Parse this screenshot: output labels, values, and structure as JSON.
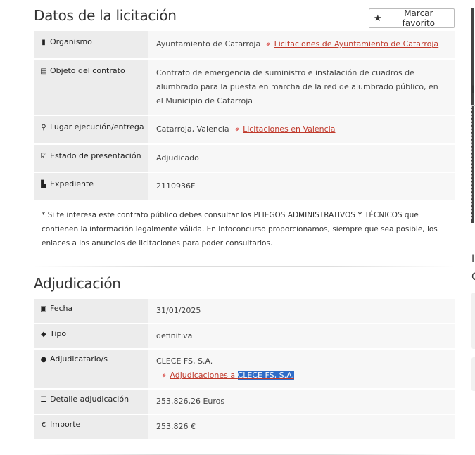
{
  "datos": {
    "title": "Datos de la licitación",
    "favorite_label": "Marcar favorito",
    "rows": [
      {
        "label": "Organismo",
        "value": "Ayuntamiento de Catarroja",
        "link": "Licitaciones de Ayuntamiento de Catarroja"
      },
      {
        "label": "Objeto del contrato",
        "value": "Contrato de emergencia de suministro e instalación de cuadros de alumbrado para la puesta en marcha de la red de alumbrado público, en el Municipio de Catarroja"
      },
      {
        "label": "Lugar ejecución/entrega",
        "value": "Catarroja, Valencia",
        "link": "Licitaciones en Valencia"
      },
      {
        "label": "Estado de presentación",
        "value": "Adjudicado"
      },
      {
        "label": "Expediente",
        "value": "2110936F"
      }
    ],
    "note": "* Si te interesa este contrato público debes consultar los PLIEGOS ADMINISTRATIVOS Y TÉCNICOS que contienen la información legalmente válida. En Infoconcurso proporcionamos, siempre que sea posible, los enlaces a los anuncios de licitaciones para poder consultarlos."
  },
  "adjudicacion": {
    "title": "Adjudicación",
    "rows": [
      {
        "label": "Fecha",
        "value": "31/01/2025"
      },
      {
        "label": "Tipo",
        "value": "definitiva"
      },
      {
        "label": "Adjudicatario/s",
        "value": "CLECE FS, S.A.",
        "link_prefix": "Adjudicaciones a ",
        "link_selected": "CLECE FS, S.A."
      },
      {
        "label": "Detalle adjudicación",
        "value": "253.826,26 Euros"
      },
      {
        "label": "Importe",
        "value": "253.826 €"
      }
    ]
  },
  "sidebar_edge": {
    "label_1": "I",
    "label_2": "I",
    "label_3": "C"
  },
  "icons": {
    "organismo": "building-icon",
    "objeto": "document-icon",
    "lugar": "map-marker-icon",
    "estado": "checkbox-icon",
    "expediente": "file-icon",
    "fecha": "calendar-check-icon",
    "tipo": "tag-icon",
    "adjudicatario": "user-icon",
    "detalle": "list-icon",
    "importe": "euro-icon",
    "link": "link-icon",
    "favorito": "star-icon"
  },
  "colors": {
    "link": "#c0392b",
    "label_bg": "#ececec",
    "value_bg": "#f7f7f7",
    "selection": "#2f6cc7"
  }
}
